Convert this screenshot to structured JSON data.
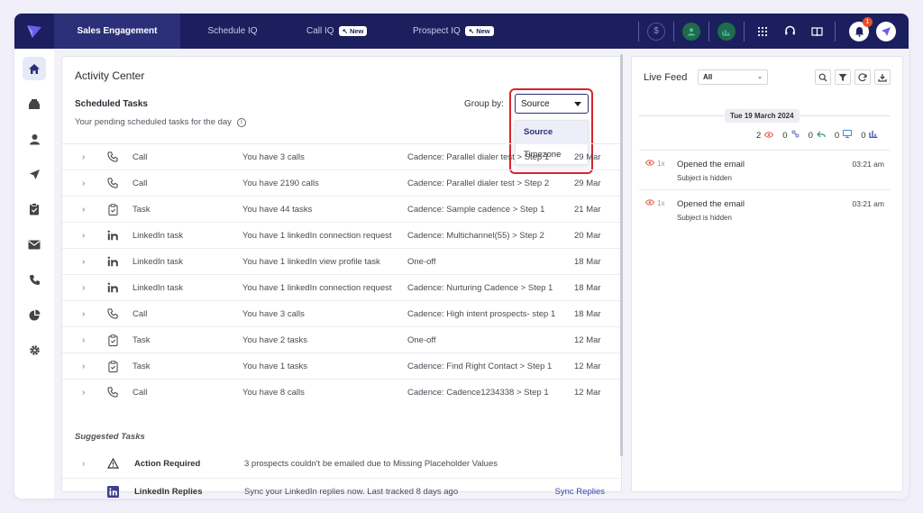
{
  "nav": {
    "tabs": [
      {
        "label": "Sales Engagement",
        "badge": ""
      },
      {
        "label": "Schedule IQ",
        "badge": ""
      },
      {
        "label": "Call IQ",
        "badge": "New"
      },
      {
        "label": "Prospect IQ",
        "badge": "New"
      }
    ],
    "notification_count": "1",
    "brand_color": "#1b1f5e"
  },
  "activity": {
    "title": "Activity Center",
    "scheduled_title": "Scheduled Tasks",
    "scheduled_sub": "Your pending scheduled tasks for the day",
    "group_by_label": "Group by:",
    "group_by_value": "Source",
    "group_options": [
      "Source",
      "Timezone"
    ],
    "tasks": [
      {
        "type": "Call",
        "icon": "phone-icon",
        "desc": "You have 3 calls",
        "source": "Cadence: Parallel dialer test > Step 1",
        "date": "29 Mar"
      },
      {
        "type": "Call",
        "icon": "phone-icon",
        "desc": "You have 2190 calls",
        "source": "Cadence: Parallel dialer test > Step 2",
        "date": "29 Mar"
      },
      {
        "type": "Task",
        "icon": "clipboard-icon",
        "desc": "You have 44 tasks",
        "source": "Cadence: Sample cadence > Step 1",
        "date": "21 Mar"
      },
      {
        "type": "LinkedIn task",
        "icon": "linkedin-icon",
        "desc": "You have 1 linkedIn connection request",
        "source": "Cadence: Multichannel(55) > Step 2",
        "date": "20 Mar"
      },
      {
        "type": "LinkedIn task",
        "icon": "linkedin-icon",
        "desc": "You have 1 linkedIn view profile task",
        "source": "One-off",
        "date": "18 Mar"
      },
      {
        "type": "LinkedIn task",
        "icon": "linkedin-icon",
        "desc": "You have 1 linkedIn connection request",
        "source": "Cadence: Nurturing Cadence > Step 1",
        "date": "18 Mar"
      },
      {
        "type": "Call",
        "icon": "phone-icon",
        "desc": "You have 3 calls",
        "source": "Cadence: High intent prospects- step 1",
        "date": "18 Mar"
      },
      {
        "type": "Task",
        "icon": "clipboard-icon",
        "desc": "You have 2 tasks",
        "source": "One-off",
        "date": "12 Mar"
      },
      {
        "type": "Task",
        "icon": "clipboard-icon",
        "desc": "You have 1 tasks",
        "source": "Cadence: Find Right Contact > Step 1",
        "date": "12 Mar"
      },
      {
        "type": "Call",
        "icon": "phone-icon",
        "desc": "You have 8 calls",
        "source": "Cadence: Cadence1234338 > Step 1",
        "date": "12 Mar"
      }
    ],
    "suggested_title": "Suggested Tasks",
    "suggested": [
      {
        "type": "Action Required",
        "icon": "warning-icon",
        "desc": "3 prospects couldn't be emailed due to Missing Placeholder Values",
        "link": ""
      },
      {
        "type": "LinkedIn Replies",
        "icon": "linkedin-icon",
        "desc": "Sync your LinkedIn replies now. Last tracked 8 days ago",
        "link": "Sync Replies"
      }
    ]
  },
  "live_feed": {
    "title": "Live Feed",
    "filter_value": "All",
    "date": "Tue 19 March 2024",
    "stats": [
      {
        "value": "2",
        "icon": "eye-icon",
        "color": "#e25a4a"
      },
      {
        "value": "0",
        "icon": "link-icon",
        "color": "#6a6fd0"
      },
      {
        "value": "0",
        "icon": "reply-icon",
        "color": "#2e9b6a"
      },
      {
        "value": "0",
        "icon": "monitor-icon",
        "color": "#3a8ad6"
      },
      {
        "value": "0",
        "icon": "chart-icon",
        "color": "#3a5fb8"
      }
    ],
    "items": [
      {
        "count": "1x",
        "title": "Opened the email",
        "sub": "Subject is hidden",
        "time": "03:21 am"
      },
      {
        "count": "1x",
        "title": "Opened the email",
        "sub": "Subject is hidden",
        "time": "03:21 am"
      }
    ]
  }
}
